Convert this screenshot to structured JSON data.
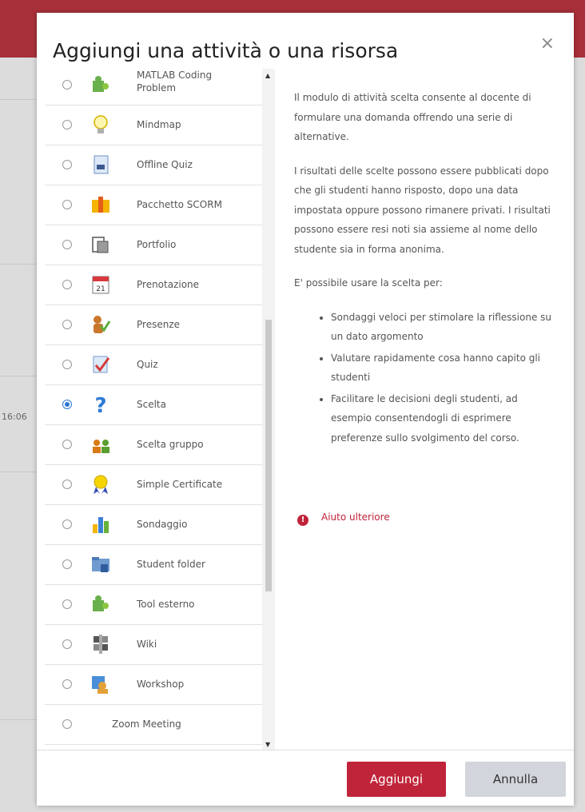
{
  "background": {
    "time": "16:06"
  },
  "modal": {
    "title": "Aggiungi una attività o una risorsa",
    "close": "×"
  },
  "items": [
    {
      "label": "MATLAB Coding Problem",
      "icon": "puzzle-icon",
      "selected": false
    },
    {
      "label": "Mindmap",
      "icon": "lightbulb-icon",
      "selected": false
    },
    {
      "label": "Offline Quiz",
      "icon": "document-icon",
      "selected": false
    },
    {
      "label": "Pacchetto SCORM",
      "icon": "package-icon",
      "selected": false
    },
    {
      "label": "Portfolio",
      "icon": "portfolio-icon",
      "selected": false
    },
    {
      "label": "Prenotazione",
      "icon": "calendar-icon",
      "selected": false,
      "calendar_day": "21"
    },
    {
      "label": "Presenze",
      "icon": "attendance-icon",
      "selected": false
    },
    {
      "label": "Quiz",
      "icon": "checkmark-icon",
      "selected": false
    },
    {
      "label": "Scelta",
      "icon": "question-icon",
      "selected": true
    },
    {
      "label": "Scelta gruppo",
      "icon": "group-icon",
      "selected": false
    },
    {
      "label": "Simple Certificate",
      "icon": "certificate-icon",
      "selected": false
    },
    {
      "label": "Sondaggio",
      "icon": "bar-chart-icon",
      "selected": false
    },
    {
      "label": "Student folder",
      "icon": "folder-icon",
      "selected": false
    },
    {
      "label": "Tool esterno",
      "icon": "puzzle-icon",
      "selected": false
    },
    {
      "label": "Wiki",
      "icon": "wiki-icon",
      "selected": false
    },
    {
      "label": "Workshop",
      "icon": "workshop-icon",
      "selected": false
    },
    {
      "label": "Zoom Meeting",
      "icon": "",
      "selected": false
    }
  ],
  "description": {
    "p1": "Il modulo di attività scelta consente al docente di formulare una domanda offrendo una serie di alternative.",
    "p2": "I risultati delle scelte possono essere pubblicati dopo che gli studenti hanno risposto, dopo una data impostata oppure possono rimanere privati. I risultati possono essere resi noti sia assieme al nome dello studente sia in forma anonima.",
    "p3": "E' possibile usare la scelta per:",
    "bullets": [
      "Sondaggi veloci per stimolare la riflessione su un dato argomento",
      "Valutare rapidamente cosa hanno capito gli studenti",
      "Facilitare le decisioni degli studenti, ad esempio consentendogli di esprimere preferenze sullo svolgimento del corso."
    ],
    "help_label": "Aiuto ulteriore",
    "help_icon": "!"
  },
  "footer": {
    "add_label": "Aggiungi",
    "cancel_label": "Annulla"
  },
  "colors": {
    "accent": "#c0243a",
    "header_bg": "#a8303a",
    "radio_selected": "#2a78d4"
  }
}
